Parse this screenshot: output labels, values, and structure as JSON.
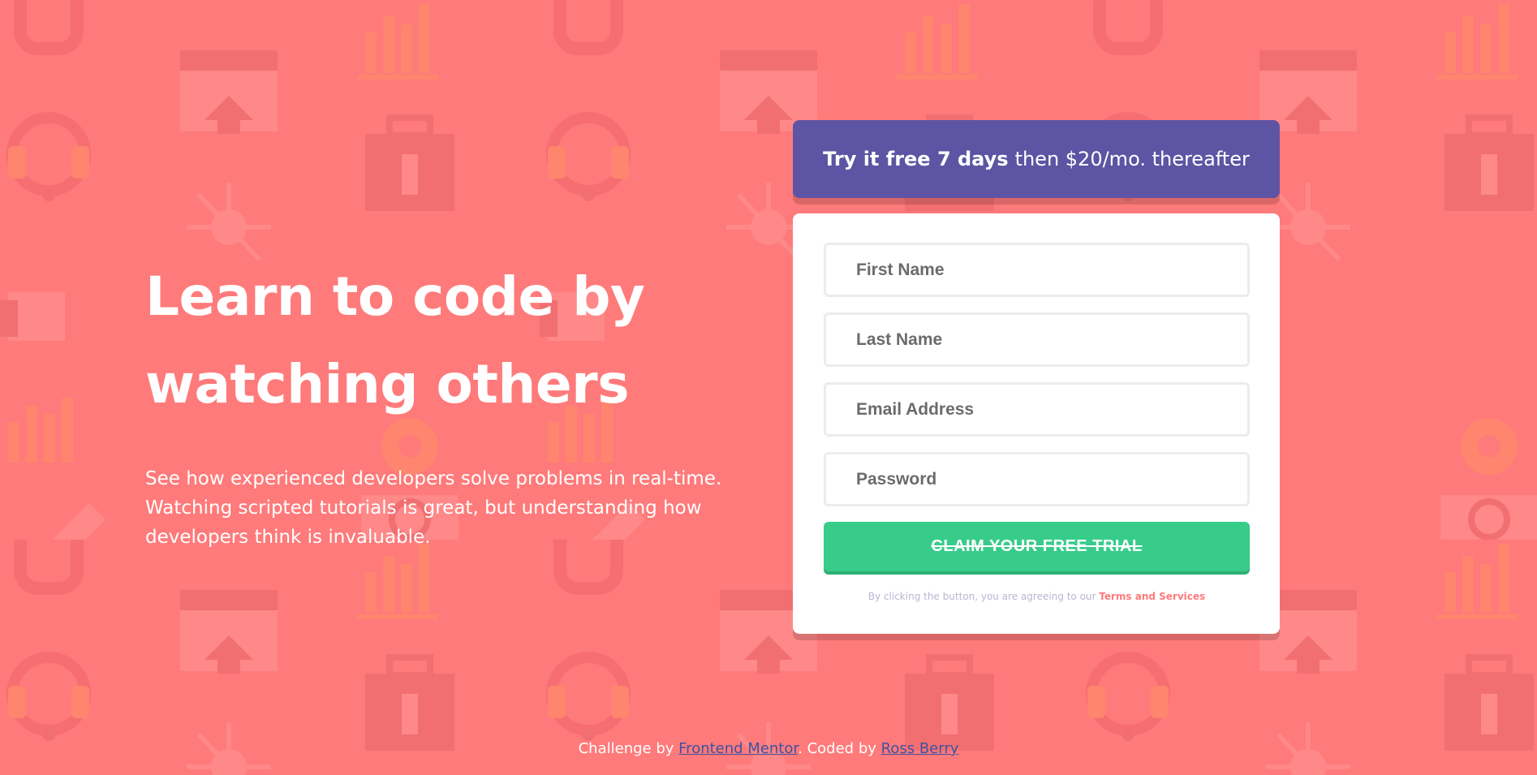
{
  "page": {
    "background_color": "#ff7a7a",
    "accent_purple": "#5e54a4",
    "accent_green": "#38cc8b"
  },
  "background_icons": [
    "link-icon",
    "bar-chart-icon",
    "browser-home-icon",
    "headset-icon",
    "toolbox-icon",
    "network-icon",
    "thumbs-up-icon",
    "rocket-icon",
    "cart-icon",
    "gear-icon",
    "globe-icon",
    "key-icon",
    "life-ring-icon",
    "browser-search-icon",
    "pencil-card-icon",
    "folder-icon"
  ],
  "hero": {
    "heading": "Learn to code by\nwatching others",
    "description": "See how experienced developers solve problems in real-time.\nWatching scripted tutorials is great, but understanding how\ndevelopers think is invaluable."
  },
  "offer": {
    "highlight": "Try it free 7 days",
    "rest": "then $20/mo. thereafter"
  },
  "form": {
    "first_name_placeholder": "First Name",
    "last_name_placeholder": "Last Name",
    "email_placeholder": "Email Address",
    "password_placeholder": "Password",
    "submit_label": "CLAIM YOUR FREE TRIAL",
    "terms_prefix": "By clicking the button, you are agreeing to our",
    "terms_link": "Terms and Services"
  },
  "footer": {
    "challenge_prefix": "Challenge by",
    "challenge_link": "Frontend Mentor",
    "coded_prefix": ". Coded by",
    "coded_link": "Ross Berry"
  }
}
